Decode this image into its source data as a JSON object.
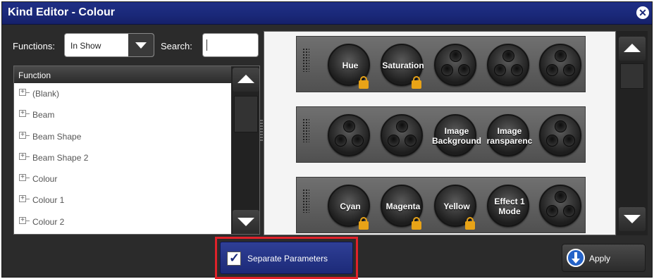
{
  "window": {
    "title": "Kind Editor - Colour",
    "close_icon": "close-icon"
  },
  "filters": {
    "functions_label": "Functions:",
    "functions_value": "In Show",
    "search_label": "Search:",
    "search_value": ""
  },
  "function_list": {
    "header": "Function",
    "items": [
      {
        "label": "(Blank)"
      },
      {
        "label": "Beam"
      },
      {
        "label": "Beam Shape"
      },
      {
        "label": "Beam Shape 2"
      },
      {
        "label": "Colour"
      },
      {
        "label": "Colour 1"
      },
      {
        "label": "Colour 2"
      }
    ]
  },
  "encoder_banks": [
    {
      "knobs": [
        {
          "label": "Hue",
          "locked": true
        },
        {
          "label": "Saturation",
          "locked": true
        },
        {
          "label": "",
          "locked": false
        },
        {
          "label": "",
          "locked": false
        },
        {
          "label": "",
          "locked": false
        }
      ]
    },
    {
      "knobs": [
        {
          "label": "",
          "locked": false
        },
        {
          "label": "",
          "locked": false
        },
        {
          "label": "Image\nBackground",
          "locked": false
        },
        {
          "label": "Image\nransparenc",
          "locked": false
        },
        {
          "label": "",
          "locked": false
        }
      ]
    },
    {
      "knobs": [
        {
          "label": "Cyan",
          "locked": true
        },
        {
          "label": "Magenta",
          "locked": true
        },
        {
          "label": "Yellow",
          "locked": true
        },
        {
          "label": "Effect 1\nMode",
          "locked": false
        },
        {
          "label": "",
          "locked": false
        }
      ]
    }
  ],
  "footer": {
    "separate_parameters_label": "Separate Parameters",
    "separate_parameters_checked": true,
    "apply_label": "Apply"
  },
  "colors": {
    "titlebar": "#1a2878",
    "highlight": "#e0222a",
    "lock": "#e8a317",
    "apply_icon": "#2563c8"
  }
}
